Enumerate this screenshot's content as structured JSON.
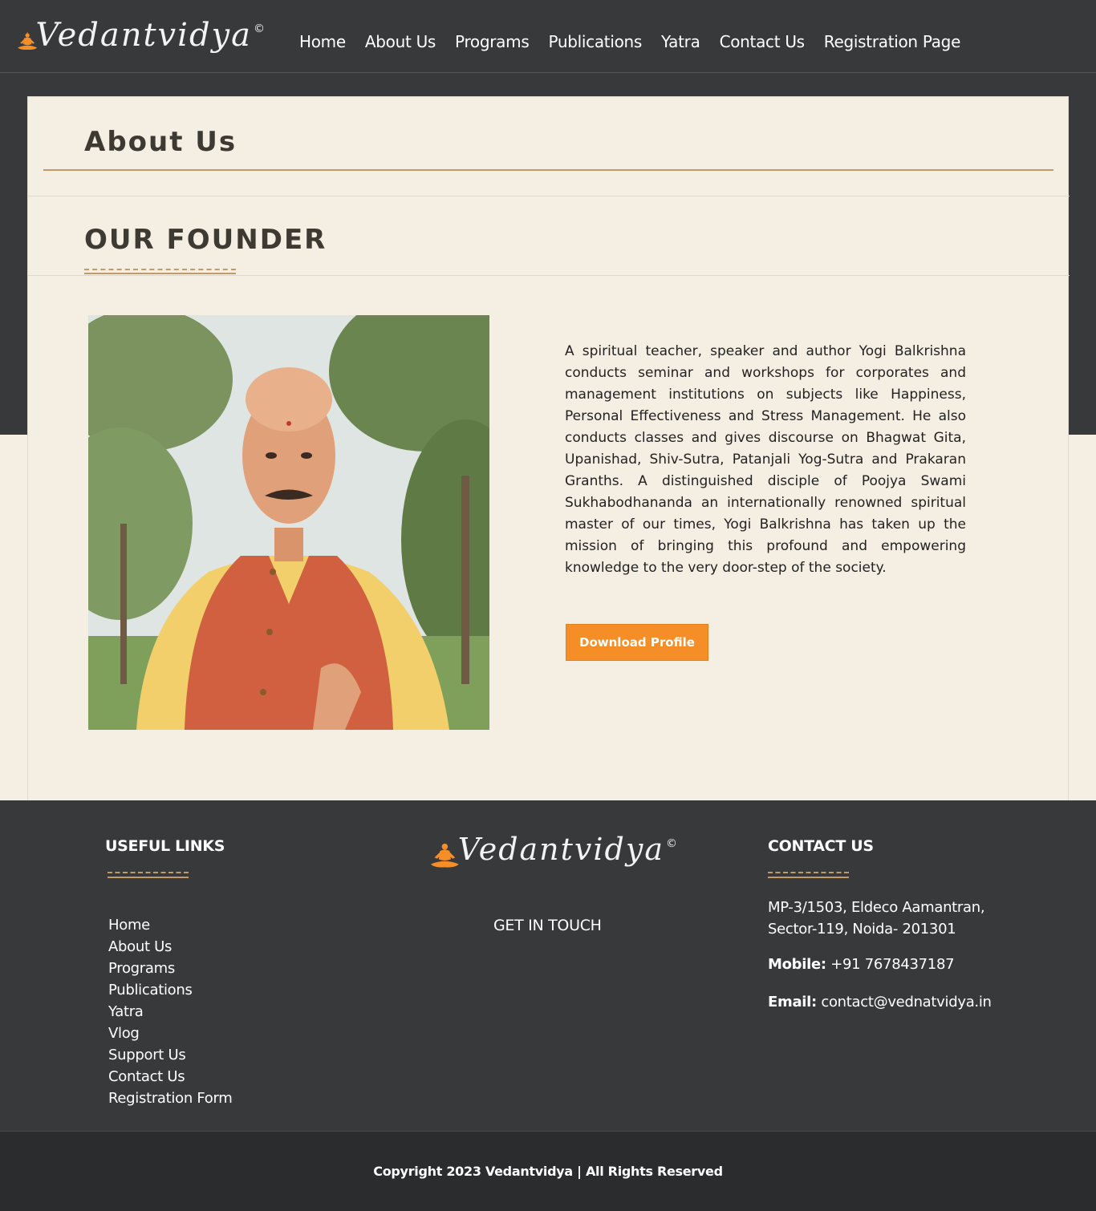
{
  "brand": {
    "name": "Vedantvidya",
    "copyright_mark": "©",
    "accent_color": "#f68e27",
    "dark_color": "#38393b",
    "cream_color": "#f5efe3",
    "gold_color": "#c29a6a"
  },
  "nav": {
    "items": [
      {
        "label": "Home"
      },
      {
        "label": "About Us"
      },
      {
        "label": "Programs"
      },
      {
        "label": "Publications"
      },
      {
        "label": "Yatra"
      },
      {
        "label": "Contact Us"
      },
      {
        "label": "Registration Page"
      }
    ]
  },
  "main": {
    "page_title": "About Us",
    "section_title": "OUR FOUNDER",
    "bio": "A spiritual teacher, speaker and author Yogi Balkrishna conducts seminar and workshops for corporates and management institutions on subjects like Happiness, Personal Effectiveness and Stress Management. He also conducts classes and gives discourse on Bhagwat Gita, Upanishad, Shiv-Sutra, Patanjali Yog-Sutra and Prakaran Granths. A distinguished disciple of Poojya Swami Sukhabodhananda an internationally renowned spiritual master of our times, Yogi Balkrishna has taken up the mission of bringing this profound and empowering knowledge to the very door-step of the society.",
    "download_label": "Download Profile"
  },
  "footer": {
    "useful_links_title": "USEFUL LINKS",
    "links": [
      {
        "label": "Home"
      },
      {
        "label": "About Us"
      },
      {
        "label": "Programs"
      },
      {
        "label": "Publications"
      },
      {
        "label": "Yatra"
      },
      {
        "label": "Vlog"
      },
      {
        "label": "Support Us"
      },
      {
        "label": "Contact Us"
      },
      {
        "label": "Registration Form"
      }
    ],
    "get_in_touch": "GET IN TOUCH",
    "contact_title": "CONTACT US",
    "address": "MP-3/1503, Eldeco Aamantran, Sector-119, Noida- 201301",
    "mobile_label": "Mobile:",
    "mobile_value": "+91 7678437187",
    "email_label": "Email:",
    "email_value": "contact@vednatvidya.in",
    "copyright": "Copyright 2023 Vedantvidya | All Rights Reserved"
  }
}
